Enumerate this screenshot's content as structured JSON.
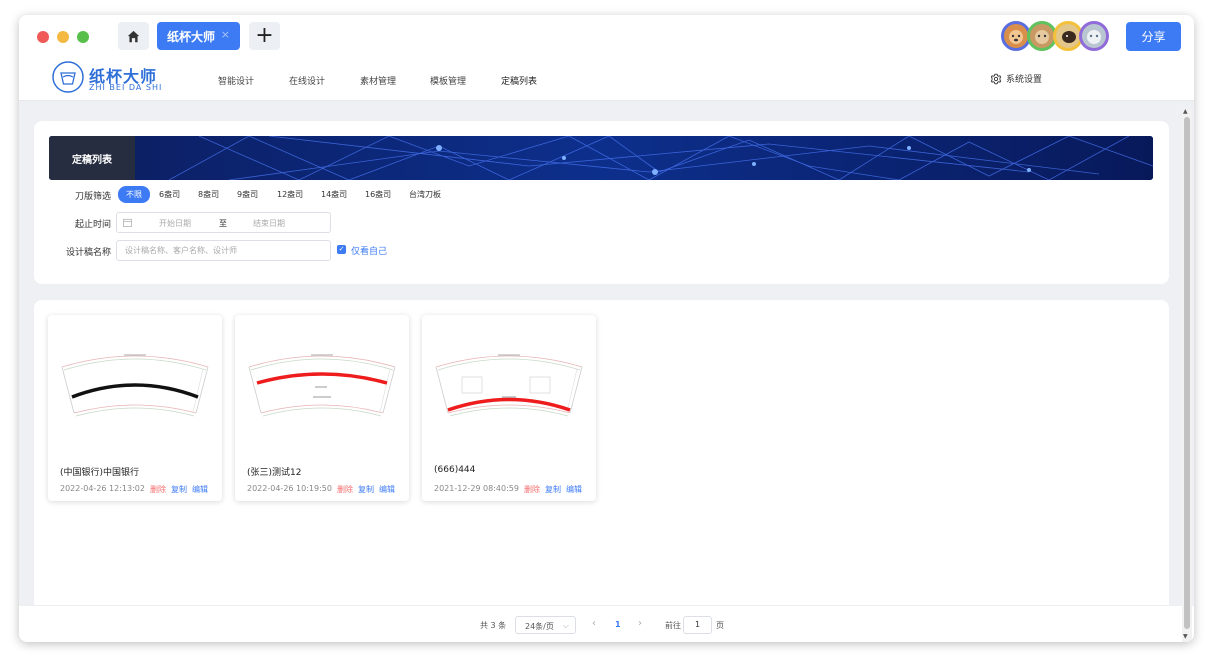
{
  "titlebar": {
    "tab_label": "纸杯大师",
    "tab_close": "×",
    "plus_label": "+",
    "share_label": "分享"
  },
  "brand": {
    "name_cn": "纸杯大师",
    "name_en": "ZHI BEI DA SHI"
  },
  "nav": {
    "items": [
      "智能设计",
      "在线设计",
      "素材管理",
      "模板管理",
      "定稿列表"
    ],
    "active_index": 4,
    "settings_label": "系统设置"
  },
  "banner": {
    "label": "定稿列表"
  },
  "filters": {
    "knife_label": "刀版筛选",
    "knife_options": [
      "不限",
      "6盎司",
      "8盎司",
      "9盎司",
      "12盎司",
      "14盎司",
      "16盎司",
      "台湾刀板"
    ],
    "knife_selected": "不限",
    "date_label": "起止时间",
    "date_start_placeholder": "开始日期",
    "date_sep": "至",
    "date_end_placeholder": "结束日期",
    "name_label": "设计稿名称",
    "name_placeholder": "设计稿名称、客户名称、设计师",
    "only_mine_label": "仅看自己",
    "only_mine_checked": true
  },
  "cards": [
    {
      "title": "(中国银行)中国银行",
      "date": "2022-04-26 12:13:02",
      "band_color": "#111111"
    },
    {
      "title": "(张三)测试12",
      "date": "2022-04-26 10:19:50",
      "band_color": "#ee1c1c"
    },
    {
      "title": "(666)444",
      "date": "2021-12-29 08:40:59",
      "band_color": "#ee1c1c"
    }
  ],
  "card_actions": {
    "delete": "删除",
    "copy": "复制",
    "edit": "编辑"
  },
  "pagination": {
    "total_text": "共 3 条",
    "page_size": "24条/页",
    "current_page": "1",
    "goto_label": "前往",
    "goto_value": "1",
    "page_unit": "页"
  },
  "colors": {
    "primary": "#3d7bf5",
    "danger": "#f56c6c",
    "brand": "#2f6fd8"
  }
}
